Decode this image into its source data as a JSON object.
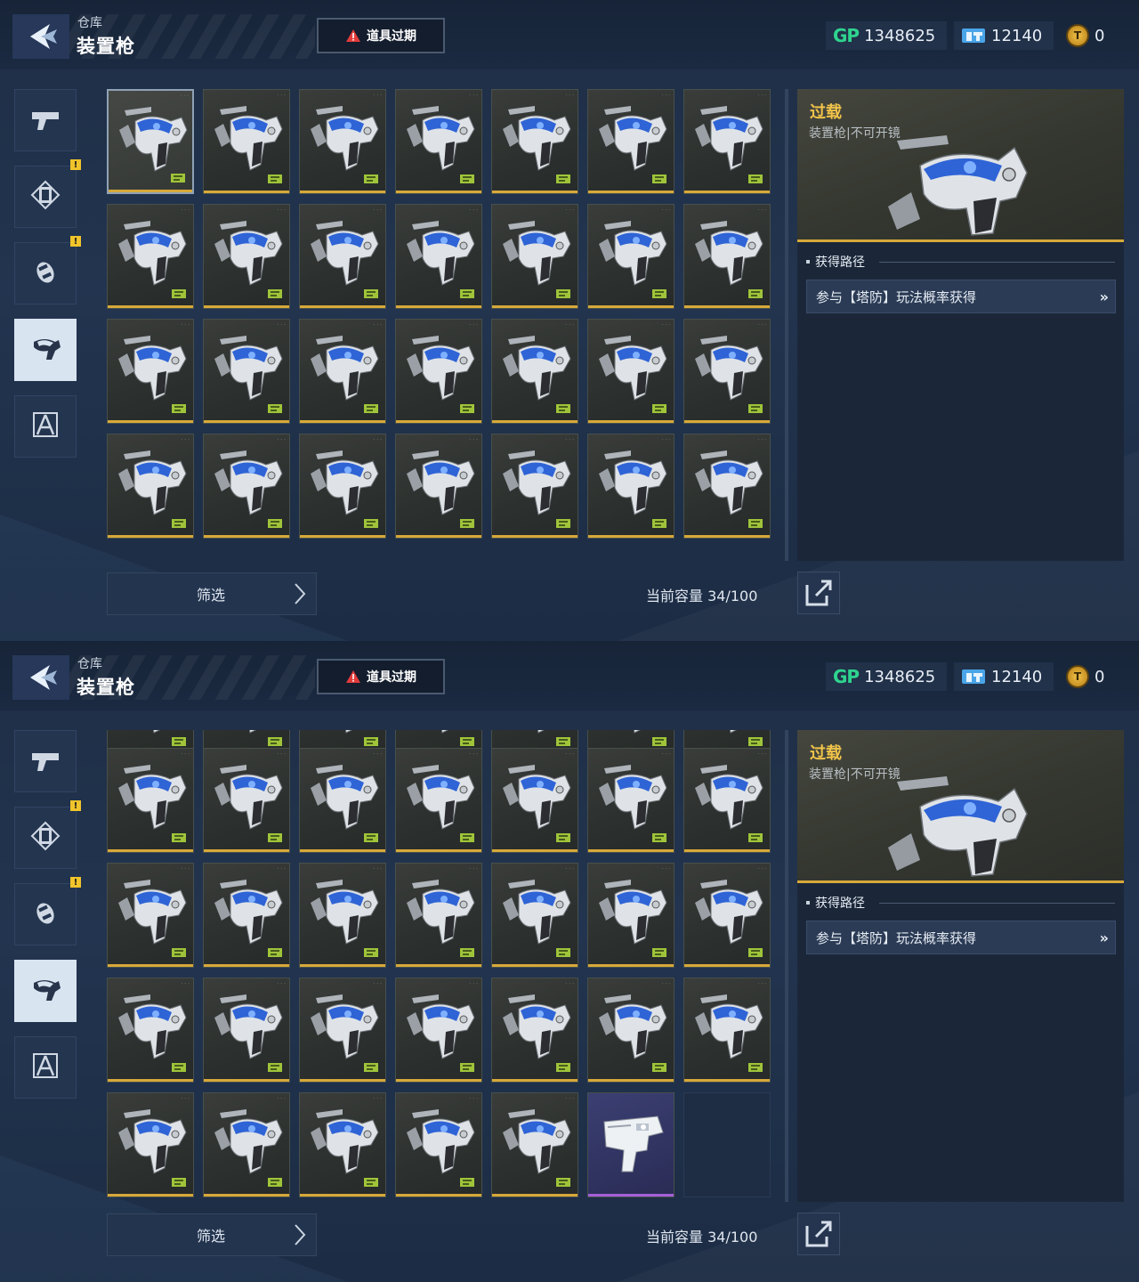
{
  "header": {
    "breadcrumb": "仓库",
    "title": "装置枪",
    "expire_label": "道具过期"
  },
  "currencies": {
    "gp": {
      "icon": "gp-icon",
      "label": "GP",
      "value": "1348625"
    },
    "ticket": {
      "icon": "ticket-icon",
      "value": "12140"
    },
    "coin": {
      "icon": "coin-icon",
      "value": "0"
    }
  },
  "side_nav": [
    {
      "name": "gun",
      "icon": "pistol-icon",
      "active": false,
      "badge": false
    },
    {
      "name": "frame",
      "icon": "frame-icon",
      "active": false,
      "badge": true
    },
    {
      "name": "grenade",
      "icon": "grenade-icon",
      "active": false,
      "badge": true
    },
    {
      "name": "device-gun",
      "icon": "device-gun-icon",
      "active": true,
      "badge": false
    },
    {
      "name": "compass",
      "icon": "compass-icon",
      "active": false,
      "badge": false
    }
  ],
  "badge_text": "!",
  "detail": {
    "item_name": "过载",
    "item_type": "装置枪|不可开镜",
    "section_title": "获得路径",
    "source_text": "参与【塔防】玩法概率获得",
    "source_chevron": "»"
  },
  "footer": {
    "filter_label": "筛选",
    "capacity": "当前容量 34/100"
  },
  "inventory": {
    "capacity_used": 34,
    "capacity_total": 100,
    "top_view": {
      "rows": 4,
      "cols": 7,
      "selected_index": 0
    },
    "bottom_view": {
      "rows": 4,
      "cols": 7,
      "special": {
        "purple_index": 26,
        "empty_index": 27
      }
    }
  },
  "colors": {
    "accent_gold": "#d7a93a",
    "item_name": "#f1c34a",
    "gp_green": "#2fd48f",
    "badge_yellow": "#f0c42b",
    "rare_purple": "#a65fd8"
  }
}
